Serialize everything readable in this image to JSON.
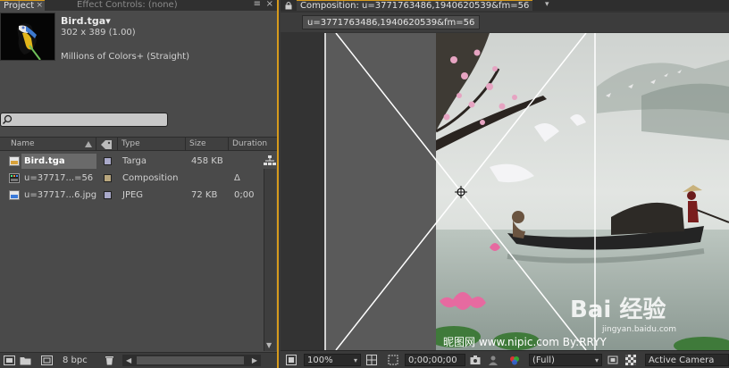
{
  "colors": {
    "accent": "#d79b1c",
    "panel_bg": "#4a4a4a",
    "selection_bg": "#6a6a6a",
    "swatch_targa": "#a9a9c9",
    "swatch_comp": "#b9a77e",
    "swatch_jpeg": "#a9a9c9"
  },
  "project_panel": {
    "tab_label": "Project",
    "tab_close": "×",
    "effect_tab_label": "Effect Controls: (none)",
    "menu_glyph": "≡",
    "close_glyph": "×",
    "selected_item": {
      "name": "Bird.tga▾",
      "dimensions": "302 x 389 (1.00)",
      "color_depth": "Millions of Colors+ (Straight)"
    },
    "search": {
      "value": "",
      "placeholder": ""
    },
    "columns": {
      "name": "Name",
      "type": "Type",
      "size": "Size",
      "duration": "Duration"
    },
    "items": [
      {
        "name": "Bird.tga",
        "type": "Targa",
        "size": "458 KB",
        "duration": "",
        "icon": "targa-file-icon"
      },
      {
        "name": "u=37717...=56",
        "type": "Composition",
        "size": "",
        "duration": "Δ 0;00",
        "icon": "composition-icon"
      },
      {
        "name": "u=37717...6.jpg",
        "type": "JPEG",
        "size": "72 KB",
        "duration": "",
        "icon": "jpeg-file-icon"
      }
    ],
    "footer": {
      "bpc": "8 bpc",
      "scroll_left": "◀",
      "scroll_right": "▶"
    },
    "scroll_down": "▼"
  },
  "composition_panel": {
    "tab_label": "Composition: u=3771763486,1940620539&fm=56",
    "tab_menu": "▾",
    "subtab_label": "u=3771763486,1940620539&fm=56",
    "artwork_caption": "昵图网 www.nipic.com By:RRYY",
    "watermark": "Bai 经验",
    "watermark_sub": "jingyan.baidu.com",
    "footer": {
      "zoom": "100%",
      "zoom_dd": "▾",
      "timecode": "0;00;00;00",
      "resolution": "(Full)",
      "resolution_dd": "▾",
      "camera": "Active Camera"
    }
  }
}
